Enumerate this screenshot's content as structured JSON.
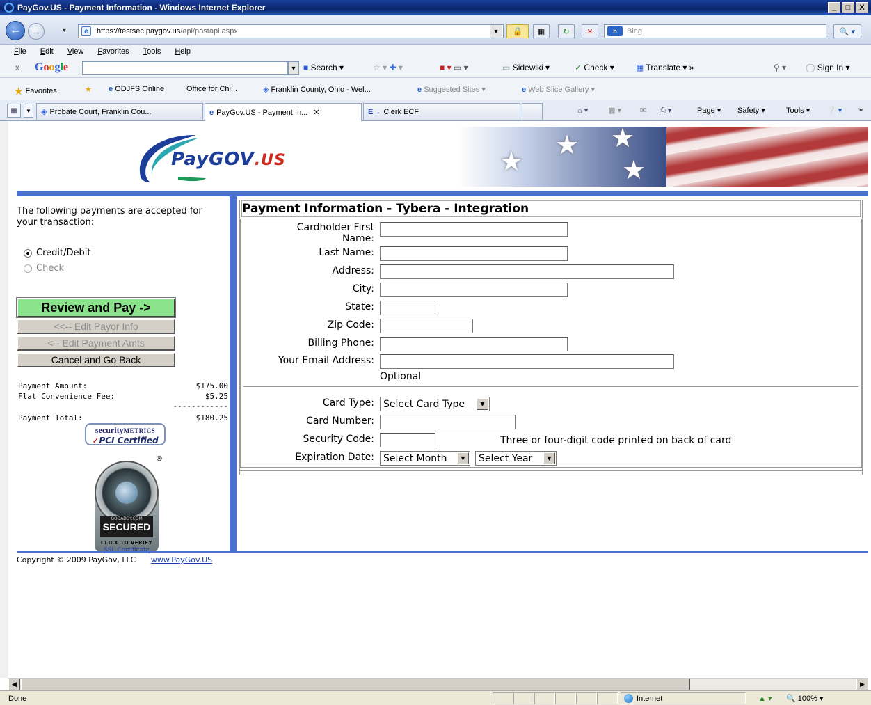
{
  "window": {
    "title": "PayGov.US - Payment Information - Windows Internet Explorer",
    "buttons": [
      "_",
      "□",
      "X"
    ]
  },
  "address": {
    "scheme": "https://",
    "host": "testsec.paygov.us",
    "path": "/api/postapi.aspx",
    "search_placeholder": "Bing",
    "search_engine_label": "b"
  },
  "menu": [
    "File",
    "Edit",
    "View",
    "Favorites",
    "Tools",
    "Help"
  ],
  "google_toolbar": {
    "close": "x",
    "search": "Search ▾",
    "sidewiki": "Sidewiki ▾",
    "check": "Check ▾",
    "translate": "Translate ▾",
    "more": "»",
    "sign_in": "Sign In ▾"
  },
  "favorites_bar": {
    "favorites": "Favorites",
    "items": [
      "ODJFS Online",
      "Office for Chi...",
      "Franklin County, Ohio - Wel...",
      "Suggested Sites ▾",
      "Web Slice Gallery ▾"
    ]
  },
  "tabs": [
    {
      "label": "Probate Court, Franklin Cou..."
    },
    {
      "label": "PayGov.US - Payment In...",
      "active": true
    },
    {
      "label": "Clerk ECF"
    }
  ],
  "command_bar": {
    "page": "Page ▾",
    "safety": "Safety ▾",
    "tools": "Tools ▾",
    "more": "»"
  },
  "brand": {
    "logo_main": "PayGOV",
    "logo_suffix": ".US"
  },
  "sidebar": {
    "accepted_text": "The following payments are accepted for your transaction:",
    "options": [
      {
        "label": "Credit/Debit",
        "selected": true,
        "enabled": true
      },
      {
        "label": "Check",
        "selected": false,
        "enabled": false
      }
    ],
    "review_button": "Review and Pay ->",
    "edit_payor_button": "<<-- Edit Payor Info",
    "edit_payment_button": "<-- Edit Payment Amts",
    "cancel_button": "Cancel and Go Back",
    "amounts": {
      "payment_amount_label": "Payment Amount:",
      "payment_amount": "$175.00",
      "fee_label": "Flat Convenience Fee:",
      "fee": "$5.25",
      "separator": "------------",
      "total_label": "Payment Total:",
      "total": "$180.25"
    },
    "security_metrics": {
      "line1_main": "security",
      "line1_small": "METRICS",
      "check": "✓",
      "line2": "PCI Certified"
    },
    "godaddy": {
      "brand": "GODADDY.COM",
      "secured": "SECURED",
      "registered": "®",
      "verify": "CLICK TO VERIFY",
      "ssl": "SSL Certificate"
    }
  },
  "form": {
    "title": "Payment Information - Tybera - Integration",
    "fields": {
      "first_name_label_1": "Cardholder First",
      "first_name_label_2": "Name:",
      "last_name_label": "Last Name:",
      "address_label": "Address:",
      "city_label": "City:",
      "state_label": "State:",
      "zip_label": "Zip Code:",
      "phone_label": "Billing Phone:",
      "email_label": "Your Email Address:",
      "email_note": "Optional",
      "card_type_label": "Card Type:",
      "card_type_value": "Select Card Type",
      "card_number_label": "Card Number:",
      "security_code_label": "Security Code:",
      "security_code_note": "Three or four-digit code printed on back of card",
      "expiration_label": "Expiration Date:",
      "month_value": "Select Month",
      "year_value": "Select Year"
    }
  },
  "footer": {
    "copyright": "Copyright © 2009 PayGov, LLC",
    "link": "www.PayGov.US"
  },
  "status": {
    "text": "Done",
    "zone": "Internet",
    "zoom": "100%"
  }
}
